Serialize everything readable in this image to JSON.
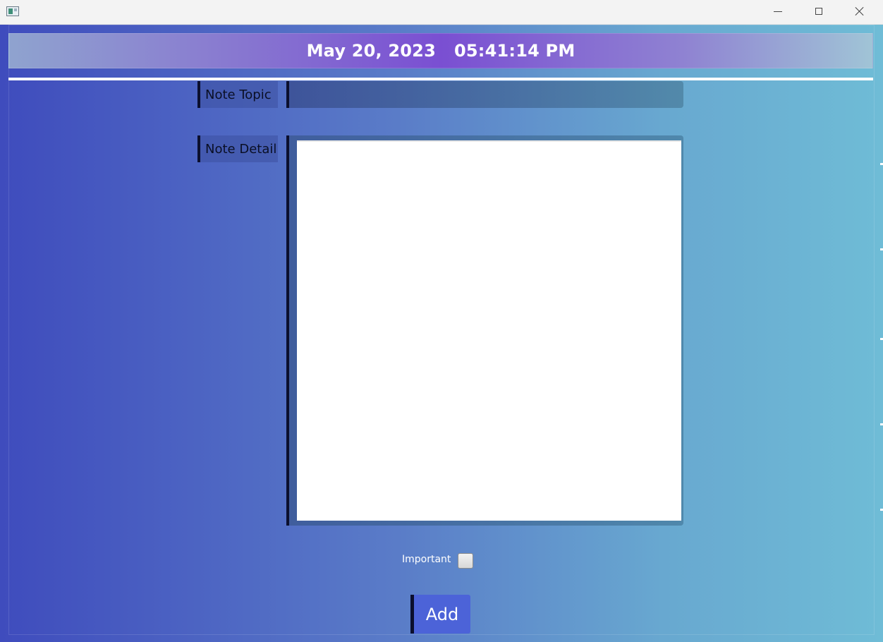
{
  "window": {
    "controls": {
      "minimize_icon": "minimize-icon",
      "maximize_icon": "maximize-icon",
      "close_icon": "close-icon"
    }
  },
  "header": {
    "date": "May 20, 2023",
    "time": "05:41:14 PM"
  },
  "form": {
    "topic_label": "Note Topic",
    "topic_value": "",
    "detail_label": "Note Detail",
    "detail_value": "",
    "important_label": "Important",
    "important_checked": false,
    "add_label": "Add"
  },
  "colors": {
    "header_accent": "#7a4fd2",
    "add_button": "#4c63d8",
    "label_border": "#0b0f2e"
  }
}
